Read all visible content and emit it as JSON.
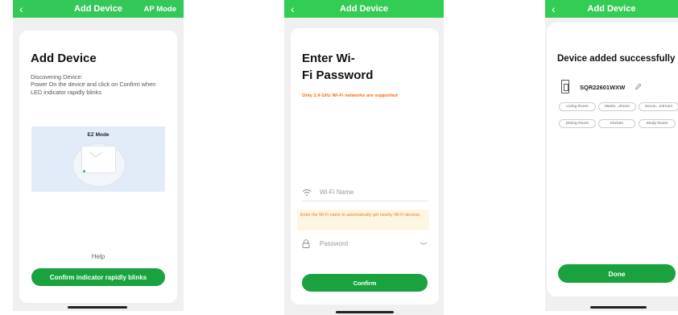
{
  "screen1": {
    "header": {
      "back": "‹",
      "title": "Add Device",
      "right": "AP Mode"
    },
    "title": "Add Device",
    "description": "Discovering Device:\nPower On the device and click on Confirm when LED indicator rapidly blinks",
    "ez_mode_label": "EZ Mode",
    "help_label": "Help",
    "confirm_button": "Confirm indicator rapidly blinks"
  },
  "screen2": {
    "header": {
      "back": "‹",
      "title": "Add Device"
    },
    "title_line1": "Enter Wi-",
    "title_line2": "Fi Password",
    "warning": "Only 2.4 GHz Wi-Fi networks are supported",
    "wifi_placeholder": "Wi-Fi Name",
    "wifi_note": "Enter the Wi-Fi name to automatically get nearby Wi-Fi devices.",
    "password_placeholder": "Password",
    "confirm_button": "Confirm"
  },
  "screen3": {
    "header": {
      "back": "‹",
      "title": "Add Device"
    },
    "title": "Device added successfully",
    "device_name": "SQR22601WXW",
    "rooms": [
      "Living Room",
      "Maste...droom",
      "Secon...edroom",
      "Dining Room",
      "Kitchen",
      "Study Room"
    ],
    "done_button": "Done"
  },
  "colors": {
    "header_green": "#34c759",
    "button_green": "#19a23e",
    "warning_orange": "#ff6a00",
    "note_background": "#fdf6e3"
  }
}
